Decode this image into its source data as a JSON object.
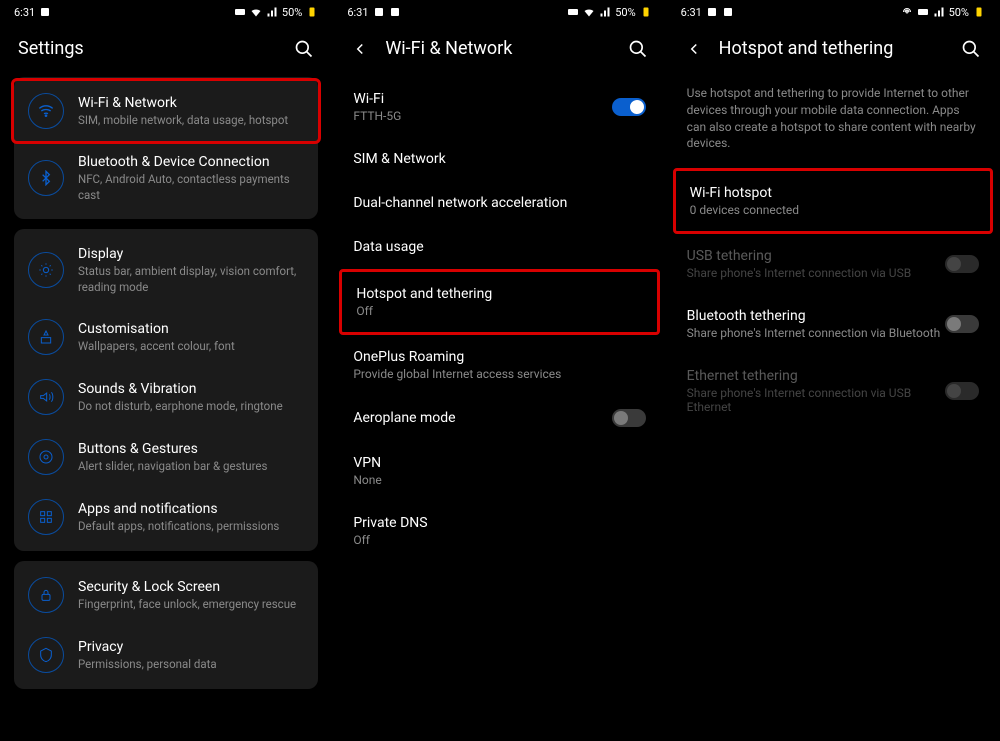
{
  "status": {
    "time": "6:31",
    "battery": "50%"
  },
  "s1": {
    "title": "Settings",
    "g1": {
      "wifi": {
        "title": "Wi-Fi & Network",
        "sub": "SIM, mobile network, data usage, hotspot"
      },
      "bt": {
        "title": "Bluetooth & Device Connection",
        "sub": "NFC, Android Auto, contactless payments cast"
      }
    },
    "g2": {
      "display": {
        "title": "Display",
        "sub": "Status bar, ambient display, vision comfort, reading mode"
      },
      "custom": {
        "title": "Customisation",
        "sub": "Wallpapers, accent colour, font"
      },
      "sound": {
        "title": "Sounds & Vibration",
        "sub": "Do not disturb, earphone mode, ringtone"
      },
      "buttons": {
        "title": "Buttons & Gestures",
        "sub": "Alert slider, navigation bar & gestures"
      },
      "apps": {
        "title": "Apps and notifications",
        "sub": "Default apps, notifications, permissions"
      }
    },
    "g3": {
      "security": {
        "title": "Security & Lock Screen",
        "sub": "Fingerprint, face unlock, emergency rescue"
      },
      "privacy": {
        "title": "Privacy",
        "sub": "Permissions, personal data"
      }
    }
  },
  "s2": {
    "title": "Wi-Fi & Network",
    "wifi": {
      "title": "Wi-Fi",
      "sub": "FTTH-5G"
    },
    "sim": {
      "title": "SIM & Network"
    },
    "dual": {
      "title": "Dual-channel network acceleration"
    },
    "data": {
      "title": "Data usage"
    },
    "hotspot": {
      "title": "Hotspot and tethering",
      "sub": "Off"
    },
    "roaming": {
      "title": "OnePlus Roaming",
      "sub": "Provide global Internet access services"
    },
    "aero": {
      "title": "Aeroplane mode"
    },
    "vpn": {
      "title": "VPN",
      "sub": "None"
    },
    "dns": {
      "title": "Private DNS",
      "sub": "Off"
    }
  },
  "s3": {
    "title": "Hotspot and tethering",
    "desc": "Use hotspot and tethering to provide Internet to other devices through your mobile data connection. Apps can also create a hotspot to share content with nearby devices.",
    "wifihs": {
      "title": "Wi-Fi hotspot",
      "sub": "0 devices connected"
    },
    "usb": {
      "title": "USB tethering",
      "sub": "Share phone's Internet connection via USB"
    },
    "bt": {
      "title": "Bluetooth tethering",
      "sub": "Share phone's Internet connection via Bluetooth"
    },
    "eth": {
      "title": "Ethernet tethering",
      "sub": "Share phone's Internet connection via USB Ethernet"
    }
  }
}
